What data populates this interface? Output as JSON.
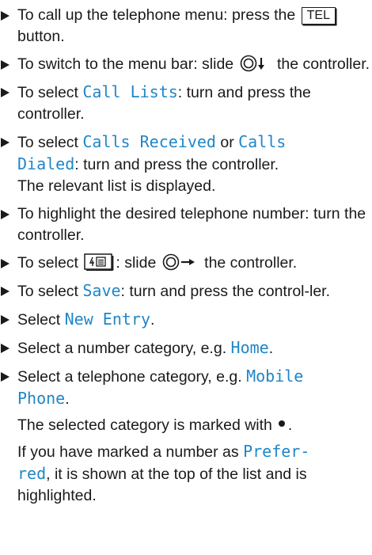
{
  "steps": [
    {
      "a": "To call up the telephone menu: press the ",
      "btn": "TEL",
      "b": " button."
    },
    {
      "a": "To switch to the menu bar: slide ",
      "b": " the controller."
    },
    {
      "a": "To select ",
      "m": "Call Lists",
      "b": ": turn and press the controller."
    },
    {
      "a": "To select ",
      "m1": "Calls Received",
      "mid": " or ",
      "m2a": "Calls",
      "m2b": "Dialed",
      "b": ": turn and press the controller.",
      "c": "The relevant list is displayed."
    },
    {
      "a": "To highlight the desired telephone number: turn the controller."
    },
    {
      "a": "To select ",
      "b": ": slide ",
      "c": " the controller."
    },
    {
      "a": "To select ",
      "m": "Save",
      "b": ": turn and press the control-ler."
    },
    {
      "a": "Select ",
      "m": "New Entry",
      "b": "."
    },
    {
      "a": "Select a number category, e.g. ",
      "m": "Home",
      "b": "."
    },
    {
      "a": "Select a telephone category, e.g. ",
      "m1": "Mobile",
      "m2": "Phone",
      "b": "."
    }
  ],
  "notes": {
    "marked_a": "The selected category is marked with",
    "marked_b": ".",
    "pref_a": "If you have marked a number as ",
    "pref_m1": "Prefer-",
    "pref_m2": "red",
    "pref_b": ", it is shown at the top of the list and is highlighted."
  },
  "colors": {
    "text": "#1a1a1a",
    "highlight": "#1f86c8"
  },
  "icons": [
    "triangle-bullet-icon",
    "controller-slide-down-icon",
    "controller-slide-right-icon",
    "phonebook-menu-icon",
    "selected-dot-icon"
  ]
}
